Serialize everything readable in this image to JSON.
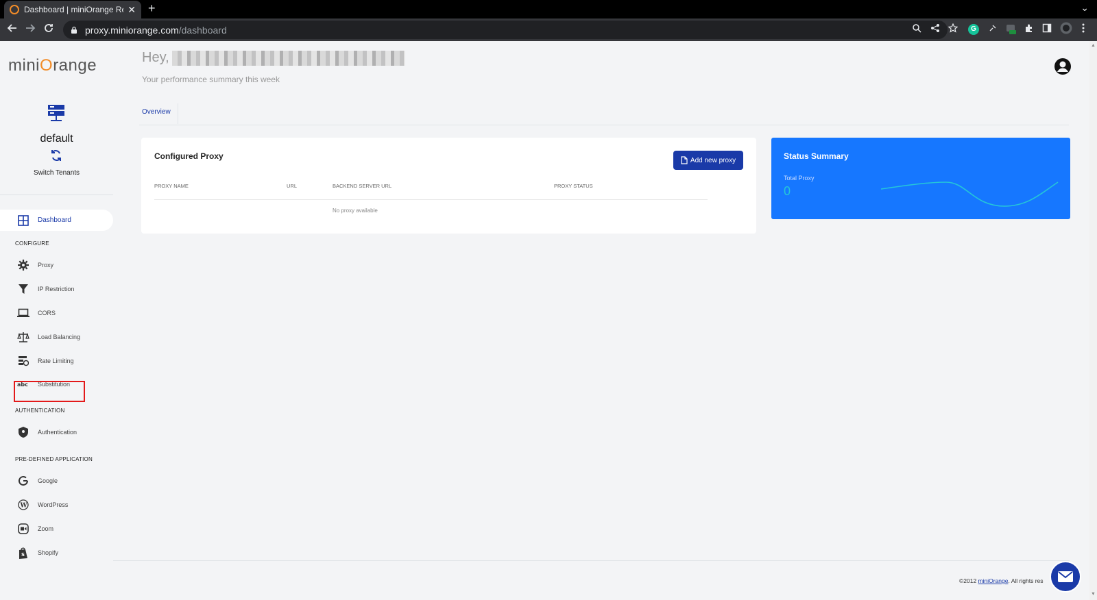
{
  "browser": {
    "tab_title": "Dashboard | miniOrange Re",
    "tab_close": "✕",
    "new_tab": "+",
    "tab_menu": "⌄",
    "url_host": "proxy.miniorange.com",
    "url_path": "/dashboard",
    "extension_badge": "G"
  },
  "sidebar": {
    "logo_prefix": "mini",
    "logo_o": "O",
    "logo_suffix": "range",
    "tenant_name": "default",
    "switch_label": "Switch Tenants",
    "dashboard_label": "Dashboard",
    "configure_heading": "CONFIGURE",
    "configure_items": [
      {
        "label": "Proxy",
        "icon": "gear-icon"
      },
      {
        "label": "IP Restriction",
        "icon": "filter-icon"
      },
      {
        "label": "CORS",
        "icon": "laptop-icon"
      },
      {
        "label": "Load Balancing",
        "icon": "scale-icon"
      },
      {
        "label": "Rate Limiting",
        "icon": "rate-limit-icon"
      },
      {
        "label": "Substitution",
        "icon": "abc-icon"
      }
    ],
    "auth_heading": "AUTHENTICATION",
    "auth_item": {
      "label": "Authentication",
      "icon": "shield-icon"
    },
    "predefined_heading": "PRE-DEFINED APPLICATION",
    "predefined_items": [
      {
        "label": "Google",
        "icon": "google-icon"
      },
      {
        "label": "WordPress",
        "icon": "wordpress-icon"
      },
      {
        "label": "Zoom",
        "icon": "zoom-icon"
      },
      {
        "label": "Shopify",
        "icon": "shopify-icon"
      }
    ]
  },
  "header": {
    "greeting": "Hey,",
    "subtitle": "Your performance summary this week"
  },
  "tabs": {
    "overview": "Overview"
  },
  "configured_proxy": {
    "title": "Configured Proxy",
    "add_button": "Add new proxy",
    "columns": [
      "PROXY NAME",
      "URL",
      "BACKEND SERVER URL",
      "PROXY STATUS"
    ],
    "empty_text": "No proxy available"
  },
  "status_summary": {
    "title": "Status Summary",
    "label": "Total Proxy",
    "value": "0"
  },
  "footer": {
    "prefix": "©2012 ",
    "link": "miniOrange",
    "suffix": ". All rights res"
  },
  "colors": {
    "accent": "#1a3aa8",
    "status_bg": "#1677ff",
    "highlight": "#e3191a",
    "brand_orange": "#f28c28"
  }
}
